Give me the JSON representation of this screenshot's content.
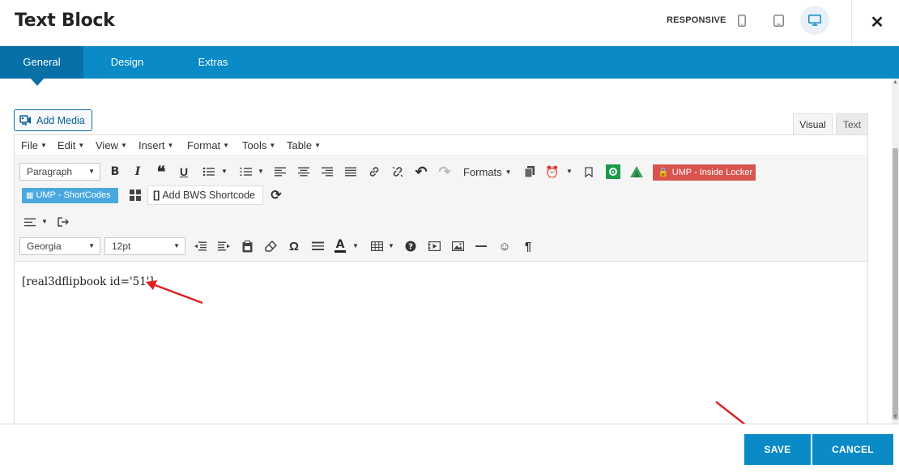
{
  "window": {
    "title": "Text Block",
    "responsive_label": "RESPONSIVE",
    "close_glyph": "✕"
  },
  "tabs": [
    {
      "label": "General",
      "active": true
    },
    {
      "label": "Design",
      "active": false
    },
    {
      "label": "Extras",
      "active": false
    }
  ],
  "media": {
    "add_media_label": "Add Media"
  },
  "editor_modes": {
    "visual": "Visual",
    "text": "Text",
    "active": "Visual"
  },
  "menubar": [
    "File",
    "Edit",
    "View",
    "Insert",
    "Format",
    "Tools",
    "Table"
  ],
  "toolbar": {
    "block_format": "Paragraph",
    "formats_label": "Formats",
    "ump_locker_label": "UMP - Inside Locker",
    "ump_shortcodes_label": "UMP - ShortCodes",
    "bws_label": "Add BWS Shortcode",
    "font_family": "Georgia",
    "font_size": "12pt",
    "text_color_letter": "A",
    "omega": "Ω",
    "pilcrow": "¶"
  },
  "content": {
    "text": "[real3dflipbook id='51']"
  },
  "footer": {
    "save_label": "SAVE",
    "cancel_label": "CANCEL"
  },
  "colors": {
    "primary": "#0a8ac6",
    "primary_dark": "#0770a6",
    "locker_red": "#d9534f",
    "shortcodes_blue": "#4aa8de",
    "annotation_arrow": "#e02020"
  },
  "icons": [
    "mobile-icon",
    "tablet-icon",
    "desktop-icon",
    "close-icon",
    "add-media-icon",
    "bold-icon",
    "italic-icon",
    "blockquote-icon",
    "underline-icon",
    "bullet-list-icon",
    "numbered-list-icon",
    "align-left-icon",
    "align-center-icon",
    "align-right-icon",
    "justify-icon",
    "link-icon",
    "unlink-icon",
    "undo-icon",
    "redo-icon",
    "copy-icon",
    "alarm-icon",
    "bookmark-icon",
    "gear-icon",
    "triangle-logo-icon",
    "lock-icon",
    "grid-icon",
    "bracket-icon",
    "refresh-icon",
    "align-menu-icon",
    "exit-icon",
    "outdent-icon",
    "indent-icon",
    "paste-icon",
    "eraser-icon",
    "omega-icon",
    "hr-icon",
    "text-color-icon",
    "table-icon",
    "help-icon",
    "media-icon",
    "image-icon",
    "horizontal-line-icon",
    "emoji-icon",
    "pilcrow-icon"
  ]
}
